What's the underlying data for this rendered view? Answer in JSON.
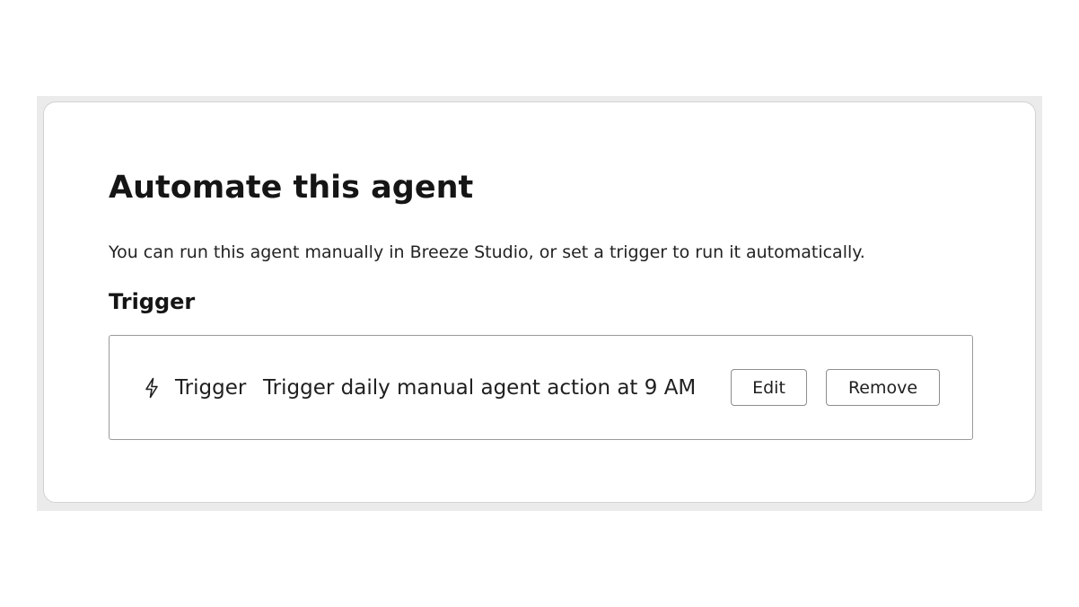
{
  "panel": {
    "title": "Automate this agent",
    "description": "You can run this agent manually in Breeze Studio, or set a trigger to run it automatically.",
    "section_heading": "Trigger"
  },
  "trigger": {
    "icon": "lightning-bolt-icon",
    "label": "Trigger",
    "text": "Trigger daily manual agent action at 9 AM",
    "edit_label": "Edit",
    "remove_label": "Remove"
  }
}
